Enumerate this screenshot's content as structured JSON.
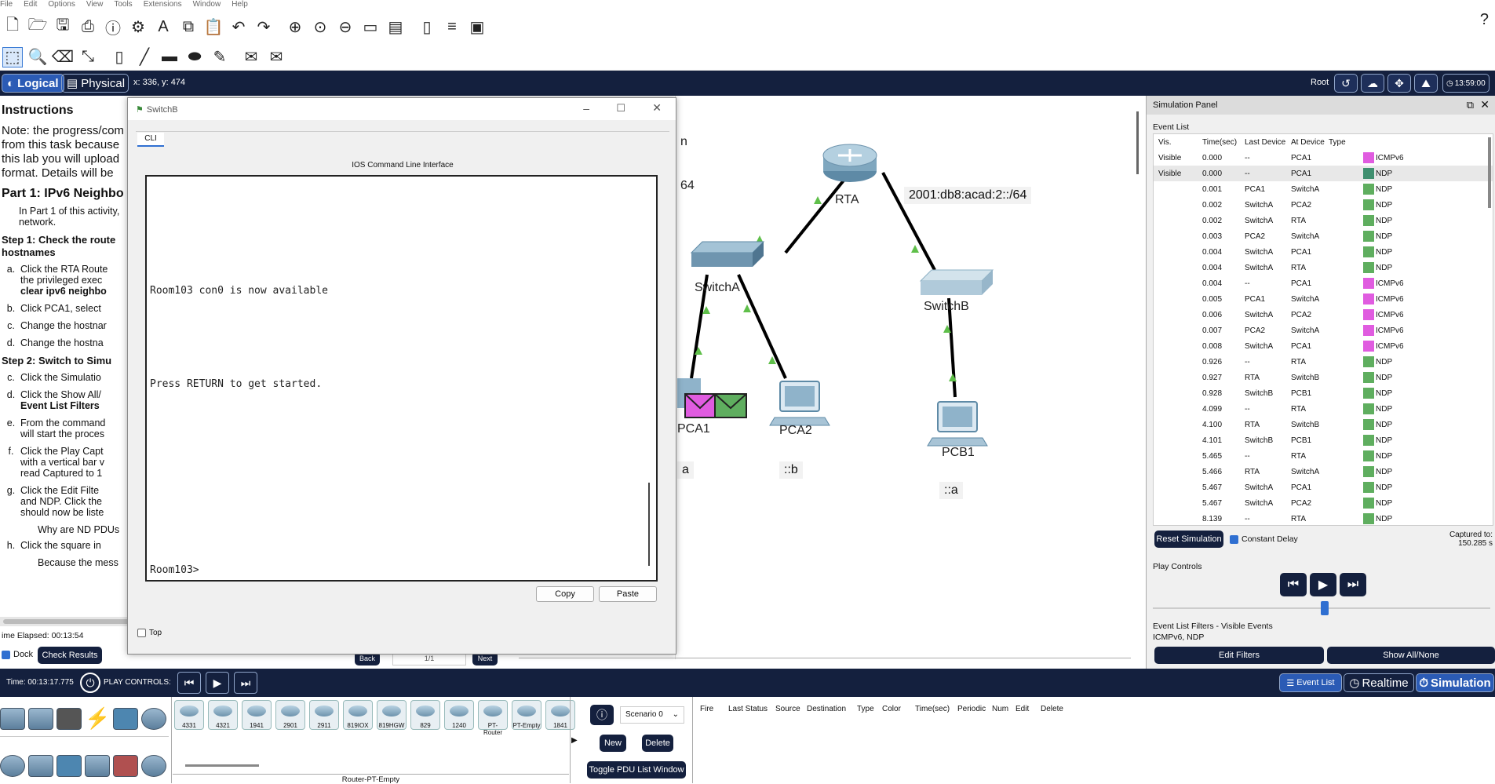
{
  "menu": [
    "File",
    "Edit",
    "Options",
    "View",
    "Tools",
    "Extensions",
    "Window",
    "Help"
  ],
  "mode": {
    "logical": "Logical",
    "physical": "Physical",
    "coords": "x: 336, y: 474",
    "root": "Root",
    "clock": "13:59:00"
  },
  "instructions": {
    "title": "Instructions",
    "note": [
      "Note: the progress/com",
      "from this task because",
      "this lab you will upload",
      "format.  Details will be"
    ],
    "part1": "Part 1: IPv6 Neighbo",
    "part1_text": [
      "In Part 1 of this activity,",
      "network."
    ],
    "step1": [
      "Step 1: Check the route",
      "hostnames"
    ],
    "step1_items": [
      {
        "k": "a.",
        "lines": [
          "Click the RTA Route",
          "the privileged exec",
          "clear ipv6 neighbo"
        ]
      },
      {
        "k": "b.",
        "lines": [
          "Click PCA1, select"
        ]
      },
      {
        "k": "c.",
        "lines": [
          "Change the hostnar"
        ]
      },
      {
        "k": "d.",
        "lines": [
          "Change the hostna"
        ]
      }
    ],
    "step2": "Step 2: Switch to Simu",
    "step2_items": [
      {
        "k": "c.",
        "lines": [
          "Click the Simulatio"
        ]
      },
      {
        "k": "d.",
        "lines": [
          "Click the Show All/",
          "Event List Filters"
        ]
      },
      {
        "k": "e.",
        "lines": [
          "From the command",
          "will start the proces"
        ]
      },
      {
        "k": "f.",
        "lines": [
          "Click the Play Capt",
          "with a vertical bar v",
          "read Captured to 1"
        ]
      },
      {
        "k": "g.",
        "lines": [
          "Click the Edit Filte",
          "and NDP. Click the",
          "should now be liste"
        ]
      }
    ],
    "why": "Why are ND PDUs",
    "h": {
      "k": "h.",
      "lines": [
        "Click the square in"
      ]
    },
    "because": "Because the mess",
    "time_elapsed": "ime Elapsed: 00:13:54",
    "dock": "Dock",
    "check_results": "Check Results",
    "back": "Back",
    "page": "1/1",
    "next": "Next"
  },
  "cli_window": {
    "title": "SwitchB",
    "tab": "CLI",
    "header": "IOS Command Line Interface",
    "lines": [
      "Room103 con0 is now available",
      "Press RETURN to get started.",
      "Room103>"
    ],
    "copy": "Copy",
    "paste": "Paste",
    "top": "Top"
  },
  "topology": {
    "rta": "RTA",
    "switcha": "SwitchA",
    "switchb": "SwitchB",
    "pca1": "PCA1",
    "pca2": "PCA2",
    "pcb1": "PCB1",
    "net_b": "2001:db8:acad:2::/64",
    "net_a_partial": "64",
    "label_partial": "n",
    "pca1_ip": "a",
    "pca2_ip": "::b",
    "pcb1_ip": "::a"
  },
  "sim_panel": {
    "title": "Simulation Panel",
    "event_list": "Event List",
    "headers": [
      "Vis.",
      "Time(sec)",
      "Last Device",
      "At Device",
      "Type"
    ],
    "events": [
      {
        "vis": "Visible",
        "time": "0.000",
        "last": "--",
        "at": "PCA1",
        "type": "ICMPv6",
        "color": "#e05ce0"
      },
      {
        "vis": "Visible",
        "time": "0.000",
        "last": "--",
        "at": "PCA1",
        "type": "NDP",
        "color": "#3f8f6f"
      },
      {
        "vis": "",
        "time": "0.001",
        "last": "PCA1",
        "at": "SwitchA",
        "type": "NDP",
        "color": "#5fae5f"
      },
      {
        "vis": "",
        "time": "0.002",
        "last": "SwitchA",
        "at": "PCA2",
        "type": "NDP",
        "color": "#5fae5f"
      },
      {
        "vis": "",
        "time": "0.002",
        "last": "SwitchA",
        "at": "RTA",
        "type": "NDP",
        "color": "#5fae5f"
      },
      {
        "vis": "",
        "time": "0.003",
        "last": "PCA2",
        "at": "SwitchA",
        "type": "NDP",
        "color": "#5fae5f"
      },
      {
        "vis": "",
        "time": "0.004",
        "last": "SwitchA",
        "at": "PCA1",
        "type": "NDP",
        "color": "#5fae5f"
      },
      {
        "vis": "",
        "time": "0.004",
        "last": "SwitchA",
        "at": "RTA",
        "type": "NDP",
        "color": "#5fae5f"
      },
      {
        "vis": "",
        "time": "0.004",
        "last": "--",
        "at": "PCA1",
        "type": "ICMPv6",
        "color": "#e05ce0"
      },
      {
        "vis": "",
        "time": "0.005",
        "last": "PCA1",
        "at": "SwitchA",
        "type": "ICMPv6",
        "color": "#e05ce0"
      },
      {
        "vis": "",
        "time": "0.006",
        "last": "SwitchA",
        "at": "PCA2",
        "type": "ICMPv6",
        "color": "#e05ce0"
      },
      {
        "vis": "",
        "time": "0.007",
        "last": "PCA2",
        "at": "SwitchA",
        "type": "ICMPv6",
        "color": "#e05ce0"
      },
      {
        "vis": "",
        "time": "0.008",
        "last": "SwitchA",
        "at": "PCA1",
        "type": "ICMPv6",
        "color": "#e05ce0"
      },
      {
        "vis": "",
        "time": "0.926",
        "last": "--",
        "at": "RTA",
        "type": "NDP",
        "color": "#5fae5f"
      },
      {
        "vis": "",
        "time": "0.927",
        "last": "RTA",
        "at": "SwitchB",
        "type": "NDP",
        "color": "#5fae5f"
      },
      {
        "vis": "",
        "time": "0.928",
        "last": "SwitchB",
        "at": "PCB1",
        "type": "NDP",
        "color": "#5fae5f"
      },
      {
        "vis": "",
        "time": "4.099",
        "last": "--",
        "at": "RTA",
        "type": "NDP",
        "color": "#5fae5f"
      },
      {
        "vis": "",
        "time": "4.100",
        "last": "RTA",
        "at": "SwitchB",
        "type": "NDP",
        "color": "#5fae5f"
      },
      {
        "vis": "",
        "time": "4.101",
        "last": "SwitchB",
        "at": "PCB1",
        "type": "NDP",
        "color": "#5fae5f"
      },
      {
        "vis": "",
        "time": "5.465",
        "last": "--",
        "at": "RTA",
        "type": "NDP",
        "color": "#5fae5f"
      },
      {
        "vis": "",
        "time": "5.466",
        "last": "RTA",
        "at": "SwitchA",
        "type": "NDP",
        "color": "#5fae5f"
      },
      {
        "vis": "",
        "time": "5.467",
        "last": "SwitchA",
        "at": "PCA1",
        "type": "NDP",
        "color": "#5fae5f"
      },
      {
        "vis": "",
        "time": "5.467",
        "last": "SwitchA",
        "at": "PCA2",
        "type": "NDP",
        "color": "#5fae5f"
      },
      {
        "vis": "",
        "time": "8.139",
        "last": "--",
        "at": "RTA",
        "type": "NDP",
        "color": "#5fae5f"
      }
    ],
    "reset": "Reset Simulation",
    "constant_delay": "Constant Delay",
    "captured_to": "Captured to:",
    "captured_value": "150.285 s",
    "play_controls": "Play Controls",
    "filters_title": "Event List Filters - Visible Events",
    "filters_value": "ICMPv6, NDP",
    "edit_filters": "Edit Filters",
    "show_all": "Show All/None"
  },
  "bottom": {
    "time": "Time: 00:13:17.775",
    "play_controls": "PLAY CONTROLS:",
    "event_list": "Event List",
    "realtime": "Realtime",
    "simulation": "Simulation"
  },
  "devices": {
    "models": [
      "4331",
      "4321",
      "1941",
      "2901",
      "2911",
      "819IOX",
      "819HGW",
      "829",
      "1240",
      "PT-Router",
      "PT-Empty",
      "1841"
    ],
    "selected": "Router-PT-Empty",
    "scenario": "Scenario 0",
    "new": "New",
    "delete": "Delete",
    "toggle": "Toggle PDU List Window",
    "pdu_headers": [
      "Fire",
      "Last Status",
      "Source",
      "Destination",
      "Type",
      "Color",
      "Time(sec)",
      "Periodic",
      "Num",
      "Edit",
      "Delete"
    ]
  }
}
